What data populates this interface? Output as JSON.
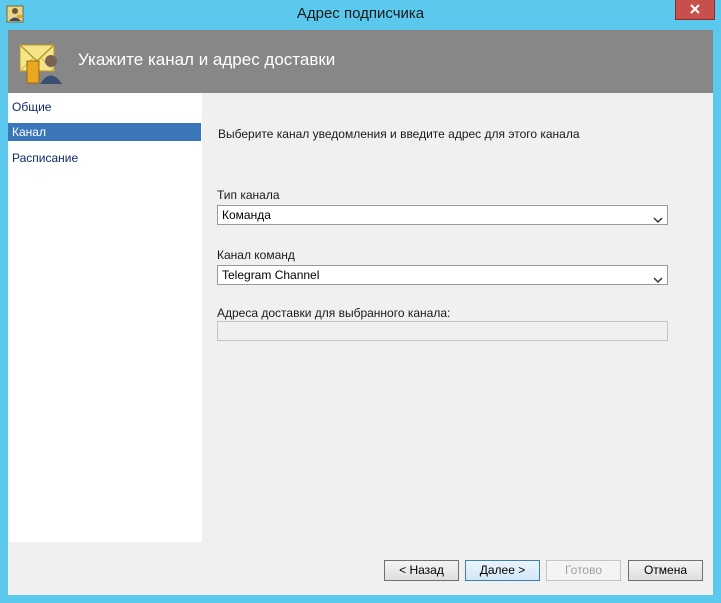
{
  "window": {
    "title": "Адрес подписчика",
    "header_title": "Укажите канал и адрес доставки"
  },
  "nav": {
    "items": [
      {
        "label": "Общие",
        "selected": false
      },
      {
        "label": "Канал",
        "selected": true
      },
      {
        "label": "Расписание",
        "selected": false
      }
    ]
  },
  "main": {
    "instruction": "Выберите канал уведомления и введите адрес для этого канала",
    "channel_type_label": "Тип канала",
    "channel_type_value": "Команда",
    "command_channel_label": "Канал команд",
    "command_channel_value": "Telegram Channel",
    "delivery_address_label": "Адреса доставки для выбранного канала:",
    "delivery_address_value": ""
  },
  "footer": {
    "back_label": "< Назад",
    "next_label": "Далее >",
    "finish_label": "Готово",
    "cancel_label": "Отмена"
  },
  "colors": {
    "frame": "#5bc8ee",
    "header_band": "#878787",
    "close_button": "#c74f4c",
    "nav_selected": "#3a76b8"
  },
  "icons": {
    "app": "user-key-icon",
    "header": "envelope-user-icon",
    "close": "close-icon",
    "dropdown": "chevron-down-icon"
  }
}
